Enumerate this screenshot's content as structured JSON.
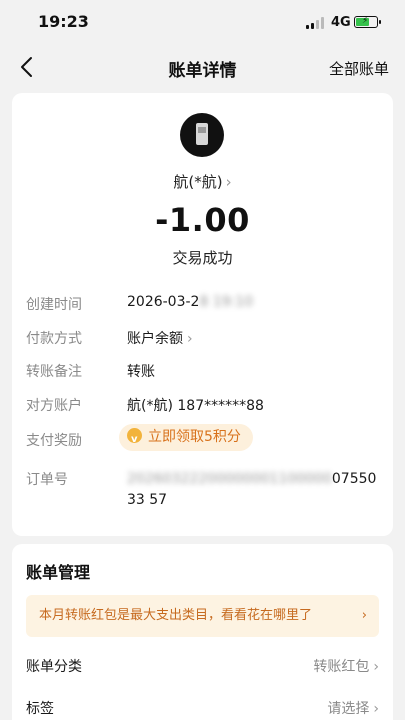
{
  "status_bar": {
    "time": "19:23",
    "network": "4G"
  },
  "nav": {
    "title": "账单详情",
    "all_bills": "全部账单"
  },
  "transaction": {
    "payee": "航(*航)",
    "amount": "-1.00",
    "status": "交易成功"
  },
  "details": [
    {
      "label": "创建时间",
      "value": "2026-03-2",
      "value_blurred": "8 19:10"
    },
    {
      "label": "付款方式",
      "value": "账户余额"
    },
    {
      "label": "转账备注",
      "value": "转账"
    },
    {
      "label": "对方账户",
      "value": "航(*航) 187******88"
    },
    {
      "label": "支付奖励",
      "value": "立即领取5积分"
    },
    {
      "label": "订单号",
      "value_blurred": "20260322200000001100000",
      "value": "0755033 57"
    }
  ],
  "manage": {
    "title": "账单管理",
    "banner": "本月转账红包是最大支出类目，看看花在哪里了",
    "rows": [
      {
        "label": "账单分类",
        "value": "转账红包"
      },
      {
        "label": "标签",
        "value": "请选择"
      }
    ]
  }
}
